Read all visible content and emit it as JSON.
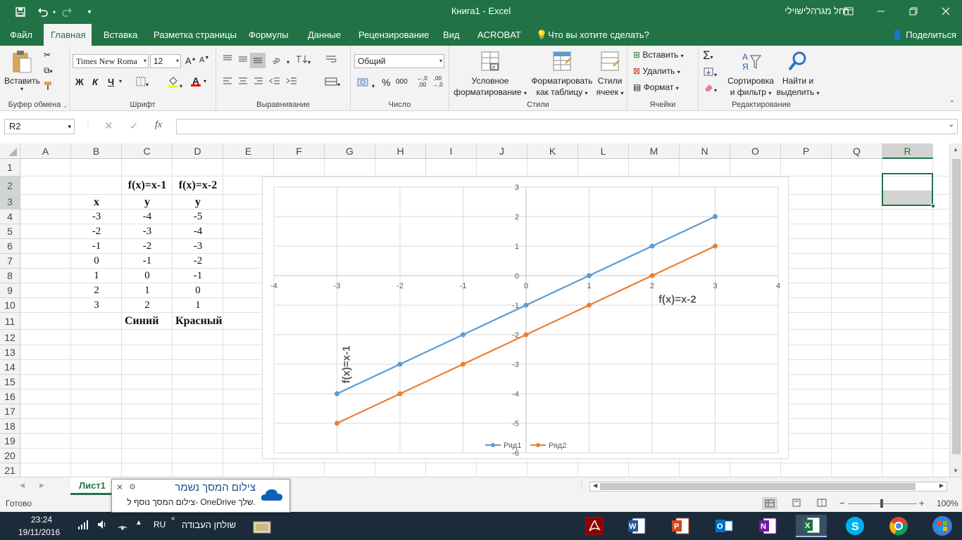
{
  "window": {
    "title": "Книга1  -  Excel",
    "user": "רחל מגרהלישוילי"
  },
  "tabs": [
    {
      "label": "Файл"
    },
    {
      "label": "Главная"
    },
    {
      "label": "Вставка"
    },
    {
      "label": "Разметка страницы"
    },
    {
      "label": "Формулы"
    },
    {
      "label": "Данные"
    },
    {
      "label": "Рецензирование"
    },
    {
      "label": "Вид"
    },
    {
      "label": "ACROBAT"
    },
    {
      "label": "Что вы хотите сделать?"
    }
  ],
  "share_label": "Поделиться",
  "ribbon": {
    "clipboard": {
      "paste": "Вставить",
      "label": "Буфер обмена"
    },
    "font": {
      "name": "Times New Roma",
      "size": "12",
      "label": "Шрифт",
      "bold": "Ж",
      "italic": "К",
      "underline": "Ч"
    },
    "alignment": {
      "label": "Выравнивание"
    },
    "number": {
      "format": "Общий",
      "label": "Число",
      "percent": "%",
      "thousands": "000"
    },
    "styles": {
      "conditional": "Условное\nформатирование",
      "conditional_1": "Условное",
      "conditional_2": "форматирование",
      "table_1": "Форматировать",
      "table_2": "как таблицу",
      "cell_1": "Стили",
      "cell_2": "ячеек",
      "label": "Стили"
    },
    "cells": {
      "insert": "Вставить",
      "delete": "Удалить",
      "format": "Формат",
      "label": "Ячейки"
    },
    "editing": {
      "sort_1": "Сортировка",
      "sort_2": "и фильтр",
      "find_1": "Найти и",
      "find_2": "выделить",
      "label": "Редактирование"
    }
  },
  "formula_bar": {
    "name_box": "R2",
    "fx": "fx",
    "formula": ""
  },
  "columns": [
    "A",
    "B",
    "C",
    "D",
    "E",
    "F",
    "G",
    "H",
    "I",
    "J",
    "K",
    "L",
    "M",
    "N",
    "O",
    "P",
    "Q",
    "R"
  ],
  "rows": [
    "1",
    "2",
    "3",
    "4",
    "5",
    "6",
    "7",
    "8",
    "9",
    "10",
    "11",
    "12",
    "13",
    "14",
    "15",
    "16",
    "17",
    "18",
    "19",
    "20",
    "21"
  ],
  "sheet": {
    "c2": "f(x)=x-1",
    "d2": "f(x)=x-2",
    "b3": "x",
    "c3": "y",
    "d3": "y",
    "b_values": [
      "-3",
      "-2",
      "-1",
      "0",
      "1",
      "2",
      "3"
    ],
    "c_values": [
      "-4",
      "-3",
      "-2",
      "-1",
      "0",
      "1",
      "2"
    ],
    "d_values": [
      "-5",
      "-4",
      "-3",
      "-2",
      "-1",
      "0",
      "1"
    ],
    "c11": "Синий",
    "d11": "Красный"
  },
  "chart_data": {
    "type": "scatter",
    "x": [
      -3,
      -2,
      -1,
      0,
      1,
      2,
      3
    ],
    "series": [
      {
        "name": "Ряд1",
        "color": "#5b9bd5",
        "values": [
          -4,
          -3,
          -2,
          -1,
          0,
          1,
          2
        ]
      },
      {
        "name": "Ряд2",
        "color": "#ed7d31",
        "values": [
          -5,
          -4,
          -3,
          -2,
          -1,
          0,
          1
        ]
      }
    ],
    "xlim": [
      -4,
      4
    ],
    "ylim": [
      -6,
      3
    ],
    "x_ticks": [
      "-4",
      "-3",
      "-2",
      "-1",
      "0",
      "1",
      "2",
      "3",
      "4"
    ],
    "y_ticks": [
      "3",
      "2",
      "1",
      "0",
      "-1",
      "-2",
      "-3",
      "-4",
      "-5",
      "-6"
    ],
    "annotations": [
      "f(x)=x-2",
      "f(x)=x-1"
    ],
    "legend": "bottom",
    "grid": true
  },
  "sheet_tab": "Лист1",
  "status": {
    "ready": "Готово",
    "zoom": "100%"
  },
  "toast": {
    "title": "צילום המסך נשמר",
    "body": "צילום המסך נוסף ל- OneDrive שלך."
  },
  "taskbar": {
    "time": "23:24",
    "date": "19/11/2016",
    "lang": "RU",
    "desktop": "שולחן העבודה"
  }
}
